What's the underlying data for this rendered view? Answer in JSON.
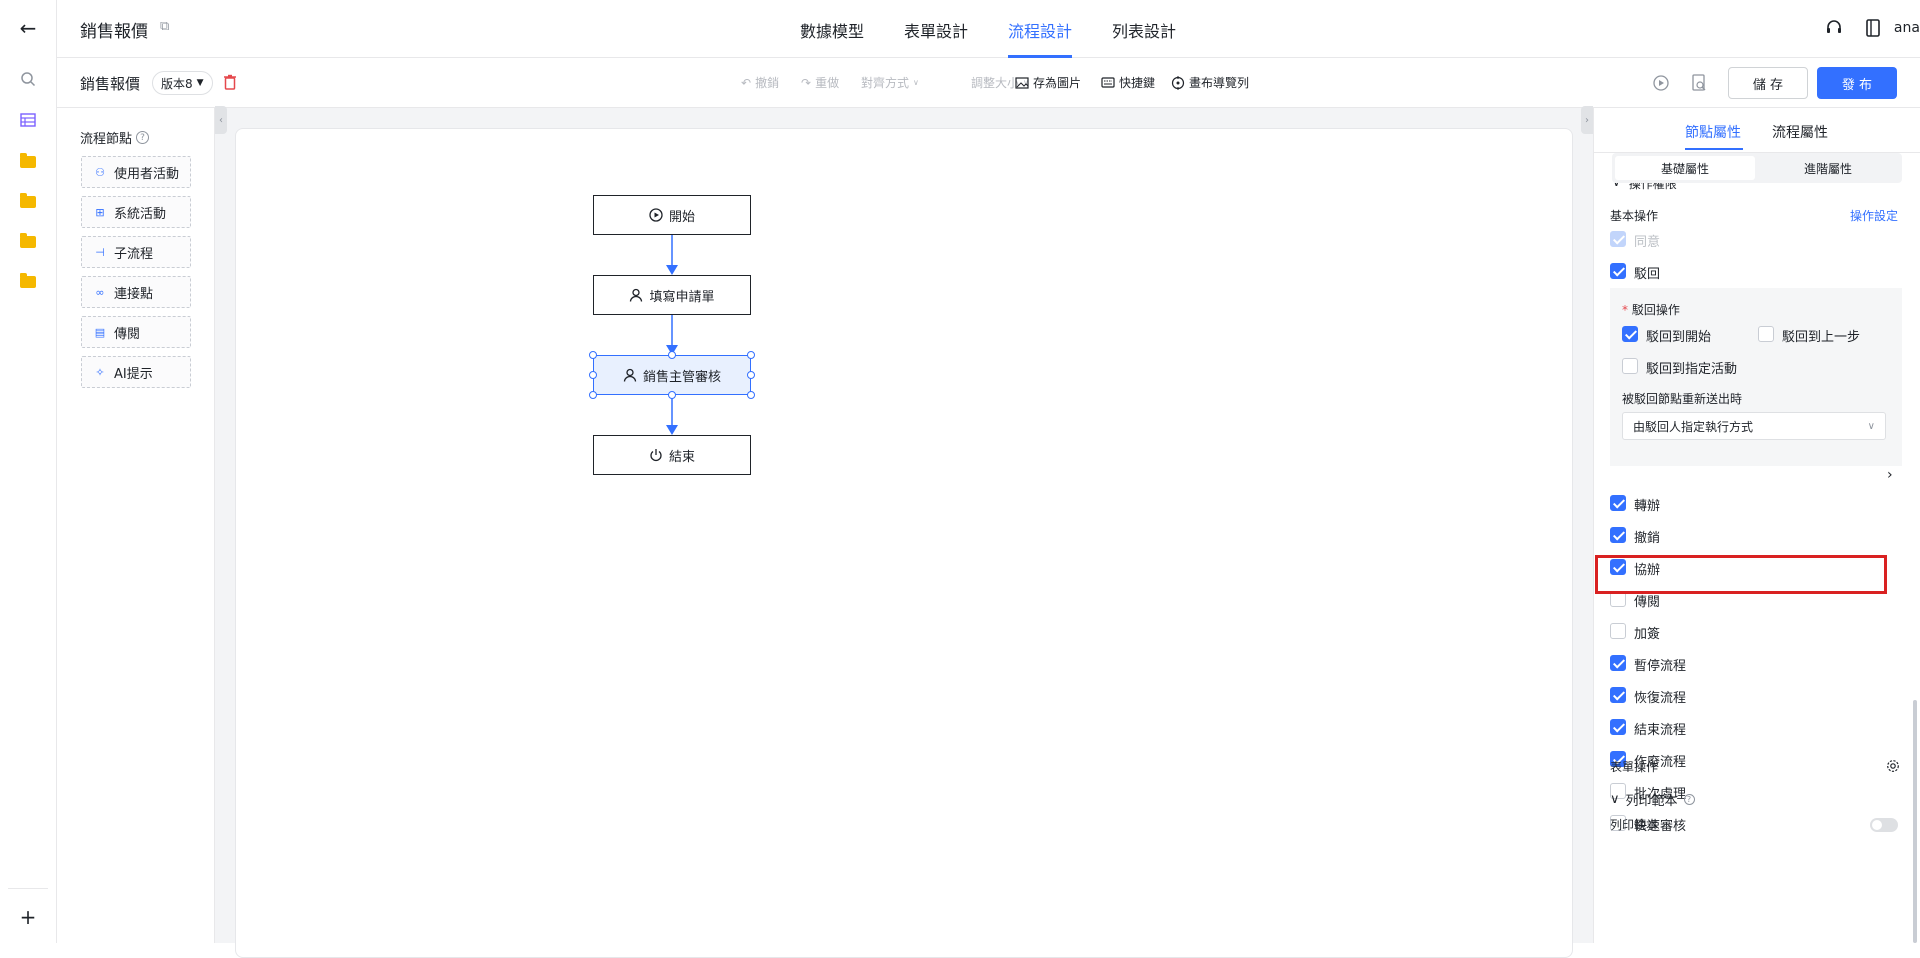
{
  "topbar": {
    "app_title": "銷售報價",
    "tabs": [
      "數據模型",
      "表單設計",
      "流程設計",
      "列表設計"
    ],
    "active_tab": "流程設計",
    "user": "ana"
  },
  "toolbar": {
    "form_name": "銷售報價",
    "version": "版本8",
    "undo": "撤銷",
    "redo": "重做",
    "align": "對齊方式",
    "resize": "調整大小",
    "save_image": "存為圖片",
    "shortcuts": "快捷鍵",
    "canvas_nav": "畫布導覽列",
    "save_button": "儲 存",
    "publish_button": "發 布"
  },
  "palette": {
    "title": "流程節點",
    "items": [
      "使用者活動",
      "系統活動",
      "子流程",
      "連接點",
      "傳閱",
      "AI提示"
    ]
  },
  "flow": {
    "nodes": [
      "開始",
      "填寫申請單",
      "銷售主管審核",
      "結束"
    ]
  },
  "panel": {
    "tabs": [
      "節點屬性",
      "流程屬性"
    ],
    "subtabs": [
      "基礎屬性",
      "進階屬性"
    ],
    "section_cut": "操作權限",
    "basic_ops_title": "基本操作",
    "op_settings_link": "操作設定",
    "agree": "同意",
    "reject": "駁回",
    "reject_ops_label": "駁回操作",
    "reject_to_start": "駁回到開始",
    "reject_to_prev": "駁回到上一步",
    "reject_to_activity": "駁回到指定活動",
    "resubmit_label": "被駁回節點重新送出時",
    "resubmit_value": "由駁回人指定執行方式",
    "ops": [
      {
        "label": "轉辦",
        "checked": true
      },
      {
        "label": "撤銷",
        "checked": true
      },
      {
        "label": "協辦",
        "checked": true
      },
      {
        "label": "傳閱",
        "checked": false
      },
      {
        "label": "加簽",
        "checked": false
      },
      {
        "label": "暫停流程",
        "checked": true
      },
      {
        "label": "恢復流程",
        "checked": true
      },
      {
        "label": "結束流程",
        "checked": true
      },
      {
        "label": "作廢流程",
        "checked": true
      },
      {
        "label": "批次處理",
        "checked": false
      },
      {
        "label": "快速審核",
        "checked": false
      }
    ],
    "form_ops_title": "表單操作",
    "print_section": "列印範本",
    "print_label": "列印範本"
  },
  "colors": {
    "accent": "#3370ff",
    "highlight": "#d92121"
  }
}
